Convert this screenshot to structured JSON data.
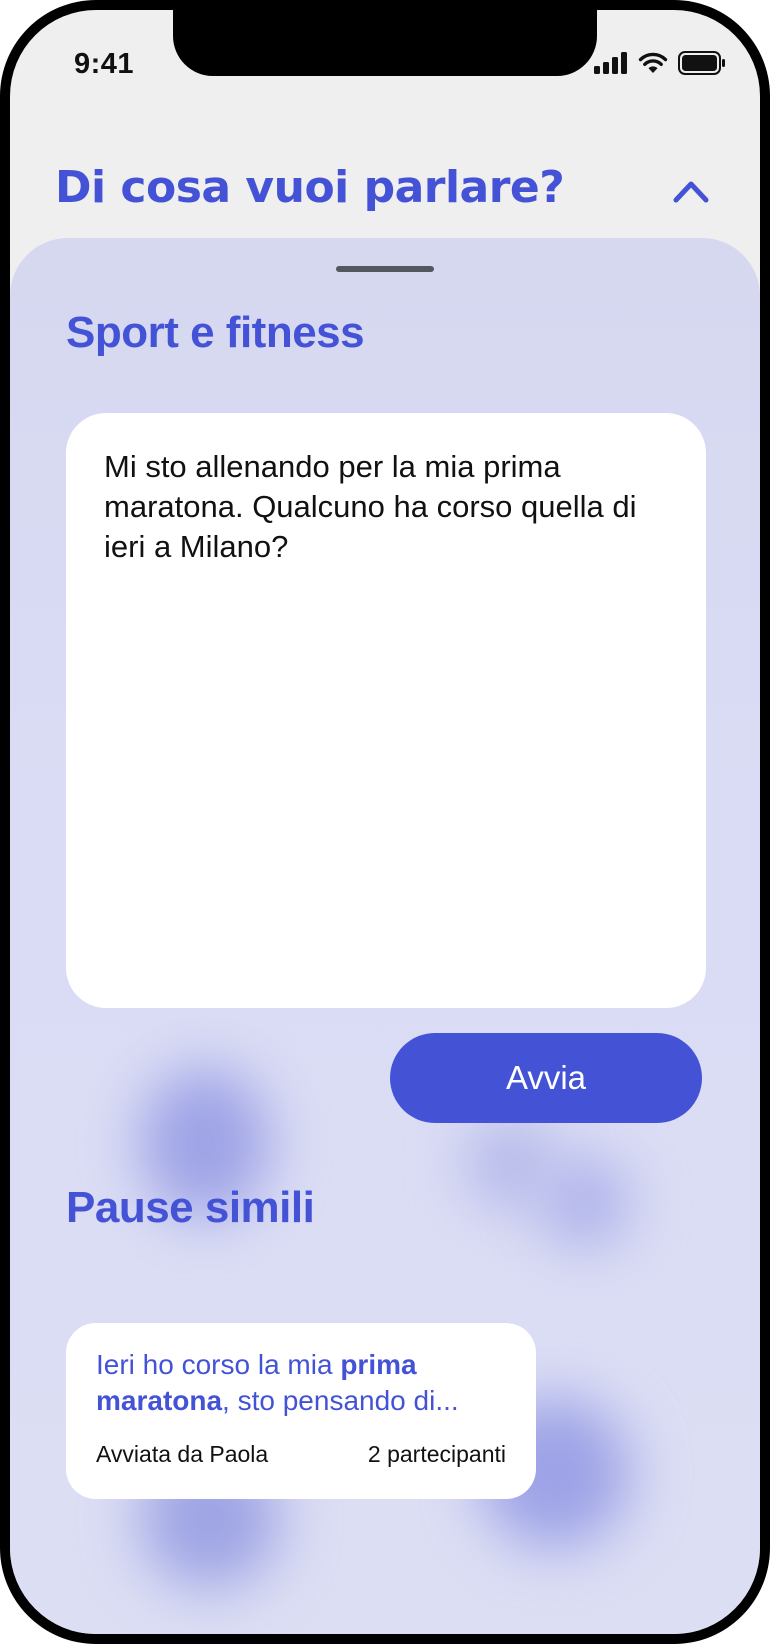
{
  "status_bar": {
    "time": "9:41",
    "icons": [
      "signal-icon",
      "wifi-icon",
      "battery-icon"
    ]
  },
  "header": {
    "title": "Di cosa vuoi parlare?",
    "toggle_icon": "chevron-up-icon"
  },
  "sheet": {
    "topic_title": "Sport e fitness",
    "message": "Mi sto allenando per la mia prima maratona. Qualcuno ha corso quella di ieri a Milano?",
    "start_button": "Avvia",
    "similar_title": "Pause simili",
    "similar": [
      {
        "text_part1": "Ieri ho corso la mia ",
        "text_bold1": "prima",
        "text_bold2": "maratona",
        "text_part2": ", sto pensando di...",
        "started_by": "Avviata da Paola",
        "participants": "2 partecipanti"
      }
    ]
  },
  "colors": {
    "accent": "#4453d6",
    "sheet_background": "#d9dbf3",
    "card_background": "#ffffff"
  }
}
